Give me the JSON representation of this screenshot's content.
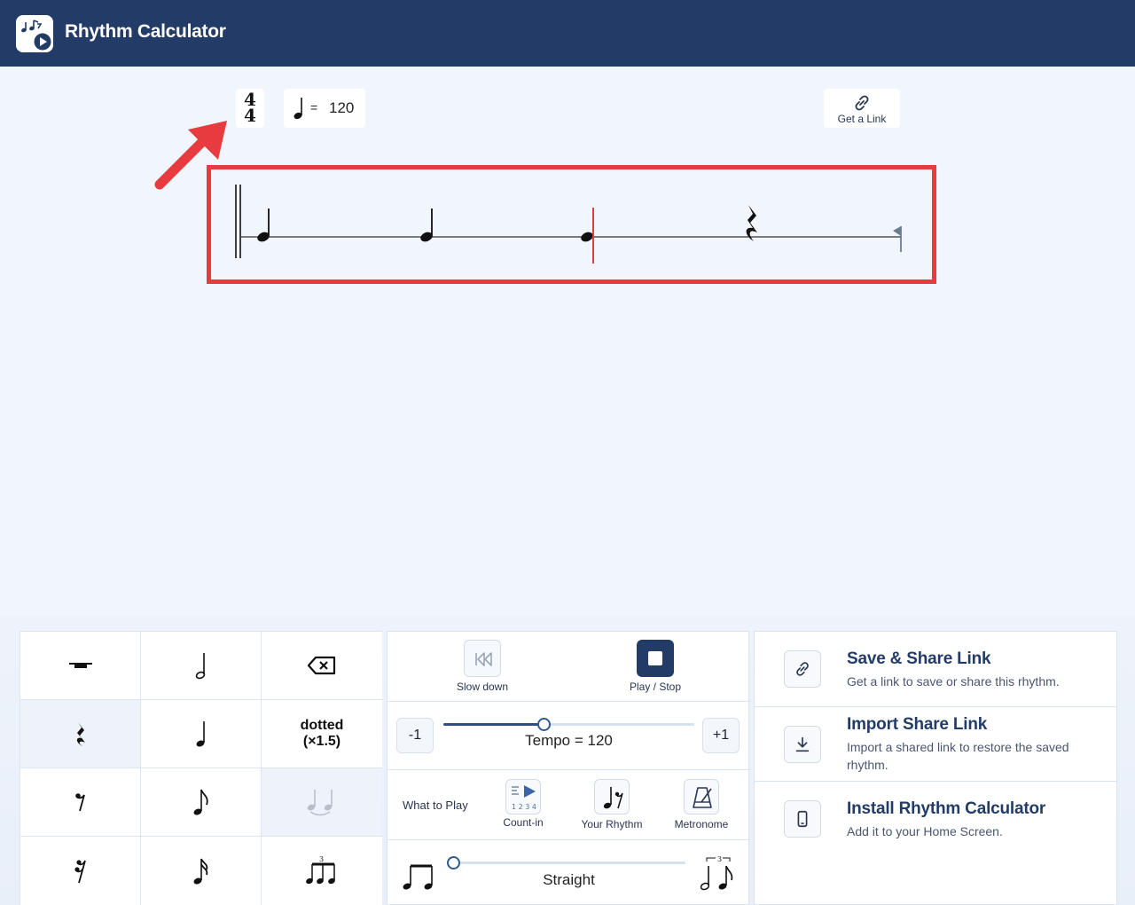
{
  "app": {
    "title": "Rhythm Calculator"
  },
  "score": {
    "time_signature": {
      "top": "4",
      "bottom": "4"
    },
    "tempo_eq": "=",
    "tempo_bpm": "120",
    "get_link_label": "Get a Link",
    "measure": [
      "quarter-note",
      "quarter-note",
      "quarter-note",
      "quarter-rest"
    ],
    "playhead_beat": 3
  },
  "palette": {
    "dotted_line1": "dotted",
    "dotted_line2": "(×1.5)"
  },
  "controls": {
    "slow_down_label": "Slow down",
    "play_stop_label": "Play / Stop",
    "minus_label": "-1",
    "plus_label": "+1",
    "tempo_text": "Tempo = 120",
    "tempo_value": 120,
    "what_to_play_label": "What to Play",
    "count_in_label": "Count-in",
    "count_in_numbers": "1 2 3 4",
    "your_rhythm_label": "Your Rhythm",
    "metronome_label": "Metronome",
    "swing_text": "Straight",
    "swing_value": 0,
    "triplet_mark": "3"
  },
  "share": {
    "items": [
      {
        "title": "Save & Share Link",
        "desc": "Get a link to save or share this rhythm."
      },
      {
        "title": "Import Share Link",
        "desc": "Import a shared link to restore the saved rhythm."
      },
      {
        "title": "Install Rhythm Calculator",
        "desc": "Add it to your Home Screen."
      }
    ]
  },
  "colors": {
    "header": "#233c67",
    "highlight": "#e83b3f",
    "accent": "#2f5a91"
  }
}
